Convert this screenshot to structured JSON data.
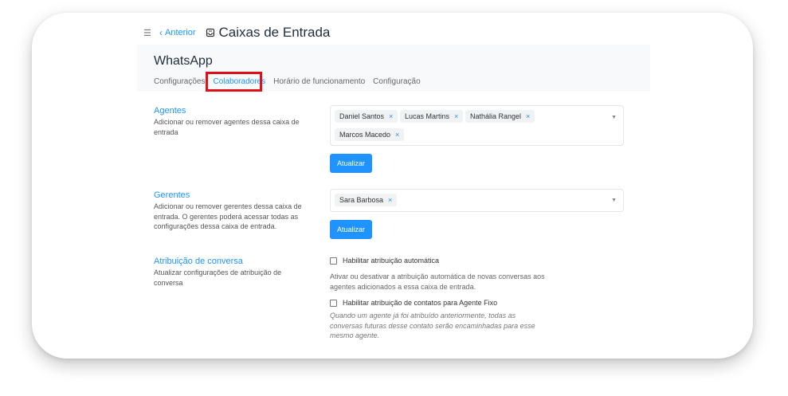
{
  "topbar": {
    "back_label": "Anterior",
    "title": "Caixas de Entrada"
  },
  "header": {
    "channel_name": "WhatsApp",
    "tabs": [
      {
        "label": "Configurações"
      },
      {
        "label": "Colaboradores"
      },
      {
        "label": "Horário de funcionamento"
      },
      {
        "label": "Configuração"
      }
    ],
    "active_tab": "Colaboradores"
  },
  "agents": {
    "title": "Agentes",
    "description": "Adicionar ou remover agentes dessa caixa de entrada",
    "selected": [
      "Daniel Santos",
      "Lucas Martins",
      "Nathália Rangel",
      "Marcos Macedo"
    ],
    "button_label": "Atualizar"
  },
  "managers": {
    "title": "Gerentes",
    "description": "Adicionar ou remover gerentes dessa caixa de entrada. O gerentes poderá acessar todas as configurações dessa caixa de entrada.",
    "selected": [
      "Sara Barbosa"
    ],
    "button_label": "Atualizar"
  },
  "assignment": {
    "title": "Atribuição de conversa",
    "description": "Atualizar configurações de atribuição de conversa",
    "auto_label": "Habilitar atribuição automática",
    "auto_help": "Ativar ou desativar a atribuição automática de novas conversas aos agentes adicionados a essa caixa de entrada.",
    "fixed_label": "Habilitar atribuição de contatos para Agente Fixo",
    "fixed_help": "Quando um agente já foi atribuído anteriormente, todas as conversas futuras desse contato serão encaminhadas para esse mesmo agente."
  },
  "colors": {
    "accent": "#1f93ff",
    "highlight": "#e0101a"
  }
}
